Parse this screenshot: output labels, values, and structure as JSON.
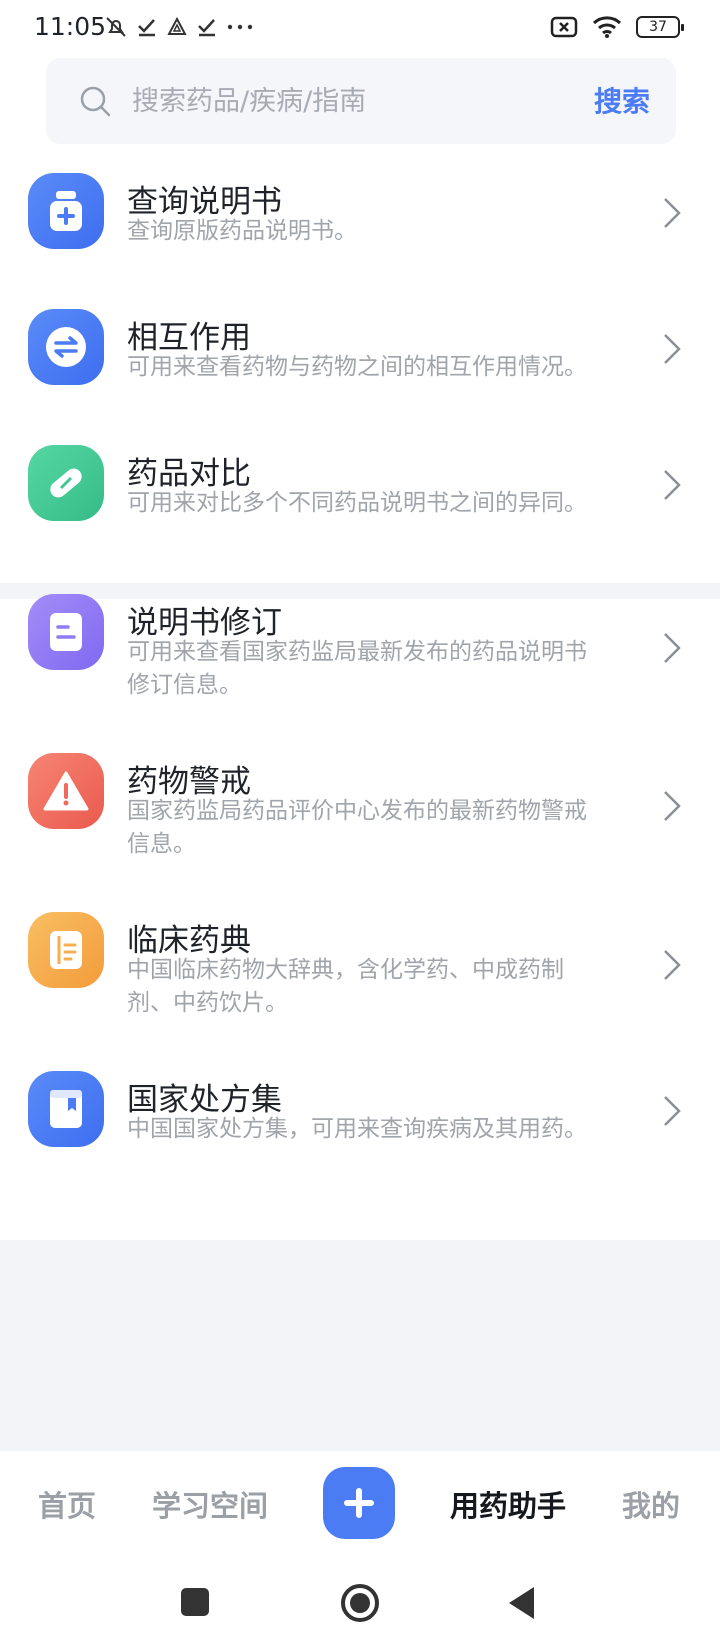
{
  "status_bar": {
    "time": "11:05",
    "battery": "37"
  },
  "search": {
    "placeholder": "搜索药品/疾病/指南",
    "button_label": "搜索"
  },
  "tools": [
    {
      "title": "查询说明书",
      "desc": "查询原版药品说明书。",
      "icon": "medicine-bottle-icon",
      "color": "#4c7cf4"
    },
    {
      "title": "相互作用",
      "desc": "可用来查看药物与药物之间的相互作用情况。",
      "icon": "swap-arrows-icon",
      "color": "#4c7cf4"
    },
    {
      "title": "药品对比",
      "desc": "可用来对比多个不同药品说明书之间的异同。",
      "icon": "pill-icon",
      "color": "#3fc795"
    }
  ],
  "updates": [
    {
      "title": "说明书修订",
      "desc": "可用来查看国家药监局最新发布的药品说明书修订信息。",
      "icon": "document-icon",
      "color": "#8f7cf6"
    },
    {
      "title": "药物警戒",
      "desc": "国家药监局药品评价中心发布的最新药物警戒信息。",
      "icon": "warning-icon",
      "color": "#f06a5e"
    },
    {
      "title": "临床药典",
      "desc": "中国临床药物大辞典，含化学药、中成药制剂、中药饮片。",
      "icon": "book-icon",
      "color": "#f7ae4c"
    },
    {
      "title": "国家处方集",
      "desc": "中国国家处方集，可用来查询疾病及其用药。",
      "icon": "bookmark-book-icon",
      "color": "#4c7cf4"
    }
  ],
  "bottom_nav": {
    "home": "首页",
    "study": "学习空间",
    "assistant": "用药助手",
    "mine": "我的"
  }
}
